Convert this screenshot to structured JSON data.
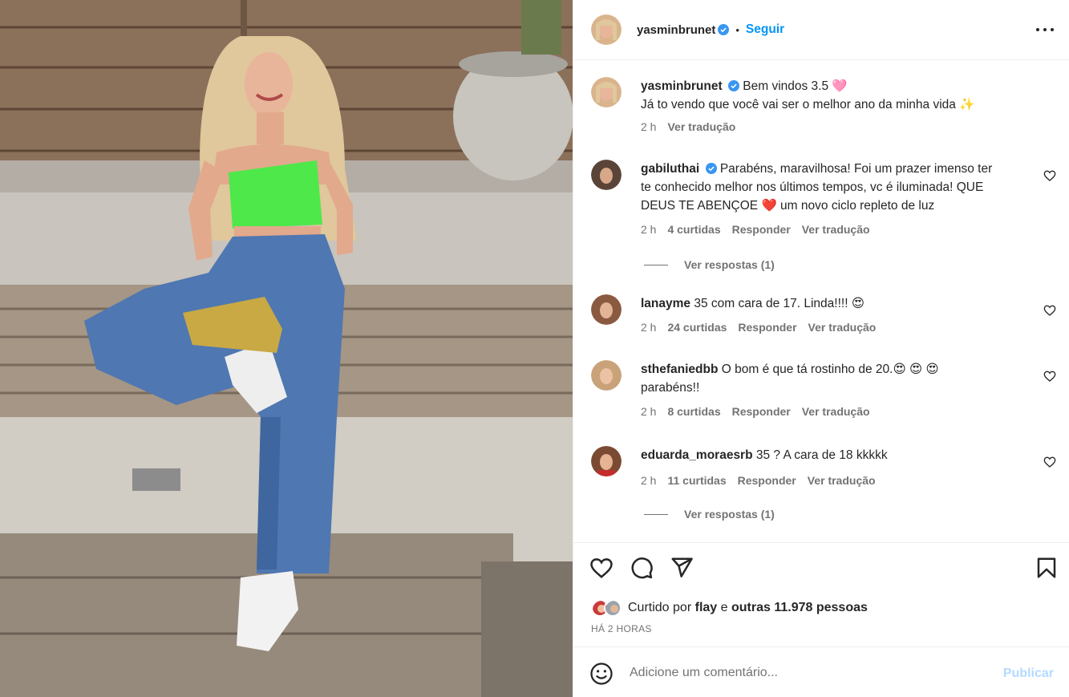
{
  "post": {
    "author": "yasminbrunet",
    "follow_label": "Seguir",
    "separator": "•",
    "caption_line1": "Bem vindos 3.5 🩷",
    "caption_line2": "Já to vendo que você vai ser o melhor ano da minha vida ✨",
    "caption_time": "2 h",
    "translate_label": "Ver tradução"
  },
  "comments": [
    {
      "user": "gabiluthai",
      "verified": true,
      "text_line1": "Parabéns, maravilhosa! Foi um prazer imenso ter",
      "text_line2": "te conhecido melhor nos últimos tempos, vc é iluminada! QUE",
      "text_line3": "DEUS TE ABENÇOE ❤️  um novo ciclo repleto de luz",
      "time": "2 h",
      "likes": "4 curtidas",
      "reply_label": "Responder",
      "translate_label": "Ver tradução",
      "replies_label": "Ver respostas (1)"
    },
    {
      "user": "lanayme",
      "text_line1": "35 com cara de 17. Linda!!!! 😍",
      "time": "2 h",
      "likes": "24 curtidas",
      "reply_label": "Responder",
      "translate_label": "Ver tradução"
    },
    {
      "user": "sthefaniedbb",
      "text_line1": "O bom é que tá rostinho de 20.😍 😍 😍",
      "text_line2": "parabéns!!",
      "time": "2 h",
      "likes": "8 curtidas",
      "reply_label": "Responder",
      "translate_label": "Ver tradução"
    },
    {
      "user": "eduarda_moraesrb",
      "text_line1": "35 ? A cara de 18 kkkkk",
      "time": "2 h",
      "likes": "11 curtidas",
      "reply_label": "Responder",
      "translate_label": "Ver tradução",
      "replies_label": "Ver respostas (1)"
    }
  ],
  "likes_bar": {
    "prefix": "Curtido por",
    "first_user": "flay",
    "conjunction": "e",
    "others": "outras 11.978 pessoas",
    "timestamp": "HÁ 2 HORAS"
  },
  "add_comment": {
    "placeholder": "Adicione um comentário...",
    "publish_label": "Publicar"
  },
  "icons": {
    "like": "heart-icon",
    "comment": "comment-icon",
    "share": "share-icon",
    "save": "bookmark-icon",
    "emoji": "emoji-icon",
    "more": "more-options-icon",
    "verified": "verified-badge-icon"
  },
  "colors": {
    "accent": "#0095f6",
    "verified": "#3897f0",
    "text": "#262626",
    "secondary": "#737373",
    "publish_disabled": "#b3dbff"
  }
}
